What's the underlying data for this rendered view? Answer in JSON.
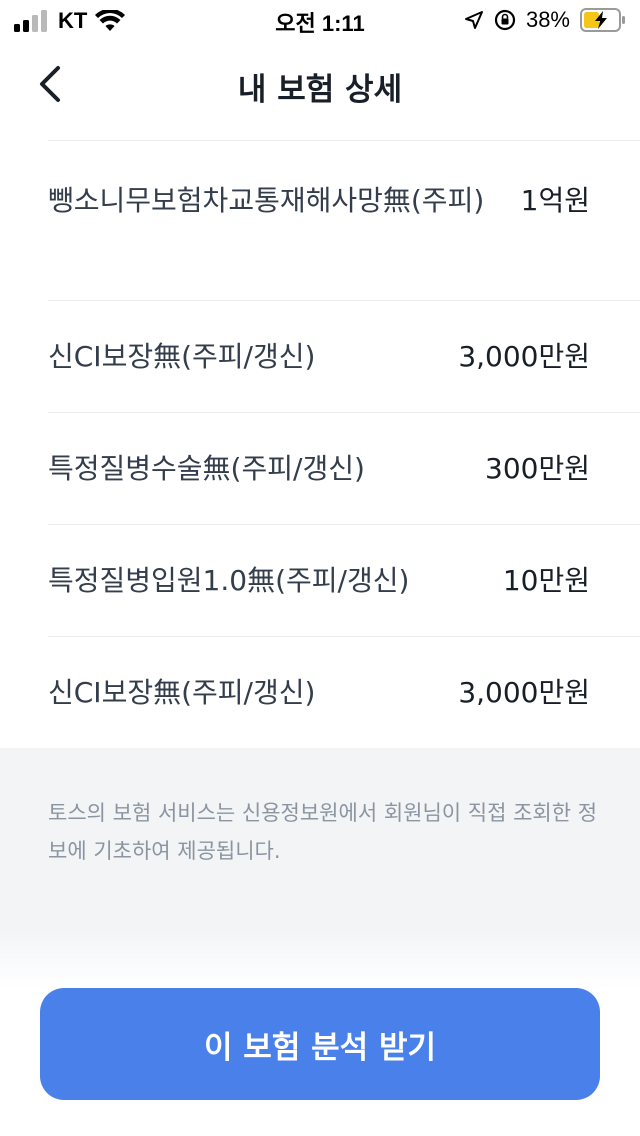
{
  "status_bar": {
    "carrier": "KT",
    "time": "오전 1:11",
    "battery_percent": "38%",
    "icons": [
      "signal-icon",
      "wifi-icon",
      "location-icon",
      "orientation-lock-icon",
      "battery-charging-icon"
    ]
  },
  "header": {
    "title": "내 보험 상세",
    "back_icon": "chevron-left-icon"
  },
  "coverages": [
    {
      "name": "뺑소니무보험차교통재해사망無(주피)",
      "amount": "1억원"
    },
    {
      "name": "신CI보장無(주피/갱신)",
      "amount": "3,000만원"
    },
    {
      "name": "특정질병수술無(주피/갱신)",
      "amount": "300만원"
    },
    {
      "name": "특정질병입원1.0無(주피/갱신)",
      "amount": "10만원"
    },
    {
      "name": "신CI보장無(주피/갱신)",
      "amount": "3,000만원"
    }
  ],
  "notice": "토스의 보험 서비스는 신용정보원에서 회원님이 직접 조회한 정보에 기초하여 제공됩니다.",
  "cta": {
    "label": "이 보험 분석 받기"
  },
  "colors": {
    "accent": "#4a80ea",
    "notice_bg": "#f2f4f6",
    "notice_text": "#8b95a1",
    "divider": "#eceef1"
  }
}
